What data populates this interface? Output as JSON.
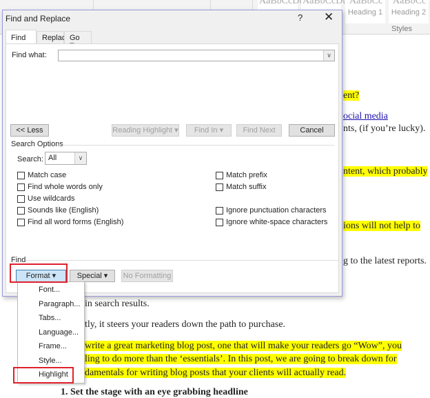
{
  "ribbon": {
    "styles": [
      {
        "preview": "AaBbCcDt",
        "name": ""
      },
      {
        "preview": "AaBbCcDt",
        "name": ""
      },
      {
        "preview": "AaBbCc",
        "name": "Heading 1"
      },
      {
        "preview": "AaBbCc",
        "name": "Heading 2"
      }
    ],
    "styles_group_label": "Styles"
  },
  "document": {
    "lines": [
      "ent?",
      "ocial media",
      "nts, (if you’re lucky).",
      "ntent, which probably",
      "ions will not help to",
      "g to the latest reports.",
      "in search results.",
      "tly, it steers your readers down the path to purchase.",
      "write a great marketing blog post, one that will make your readers go “Wow”, you",
      "ling to do more than the ‘essentials’.  In this post, we are going to break down for",
      "damentals for writing blog posts that your clients will actually read.",
      "1.   Set the stage with an eye grabbing headline"
    ],
    "highlight_color": "#ffff00",
    "link_color": "#1a0dab"
  },
  "dialog": {
    "title": "Find and Replace",
    "help": "?",
    "close": "✕",
    "tabs": [
      {
        "label": "Find",
        "active": true
      },
      {
        "label": "Replace"
      },
      {
        "label": "Go To"
      }
    ],
    "find_what_label": "Find what:",
    "find_what_value": "",
    "buttons": {
      "less": "<< Less",
      "reading_highlight": "Reading Highlight ▾",
      "find_in": "Find In ▾",
      "find_next": "Find Next",
      "cancel": "Cancel"
    },
    "search_options_label": "Search Options",
    "search_label": "Search:",
    "search_value": "All",
    "options_left": [
      {
        "label": "Match case",
        "checked": false
      },
      {
        "label": "Find whole words only",
        "checked": false
      },
      {
        "label": "Use wildcards",
        "checked": false
      },
      {
        "label": "Sounds like (English)",
        "checked": false
      },
      {
        "label": "Find all word forms (English)",
        "checked": false
      }
    ],
    "options_right": [
      {
        "label": "Match prefix",
        "checked": false
      },
      {
        "label": "Match suffix",
        "checked": false
      },
      {
        "label": "Ignore punctuation characters",
        "checked": false
      },
      {
        "label": "Ignore white-space characters",
        "checked": false
      }
    ],
    "find_group_label": "Find",
    "format_button": "Format ▾",
    "special_button": "Special ▾",
    "no_formatting_button": "No Formatting"
  },
  "format_menu": {
    "items": [
      "Font...",
      "Paragraph...",
      "Tabs...",
      "Language...",
      "Frame...",
      "Style...",
      "Highlight"
    ]
  },
  "annotation_color": "#e0202a"
}
